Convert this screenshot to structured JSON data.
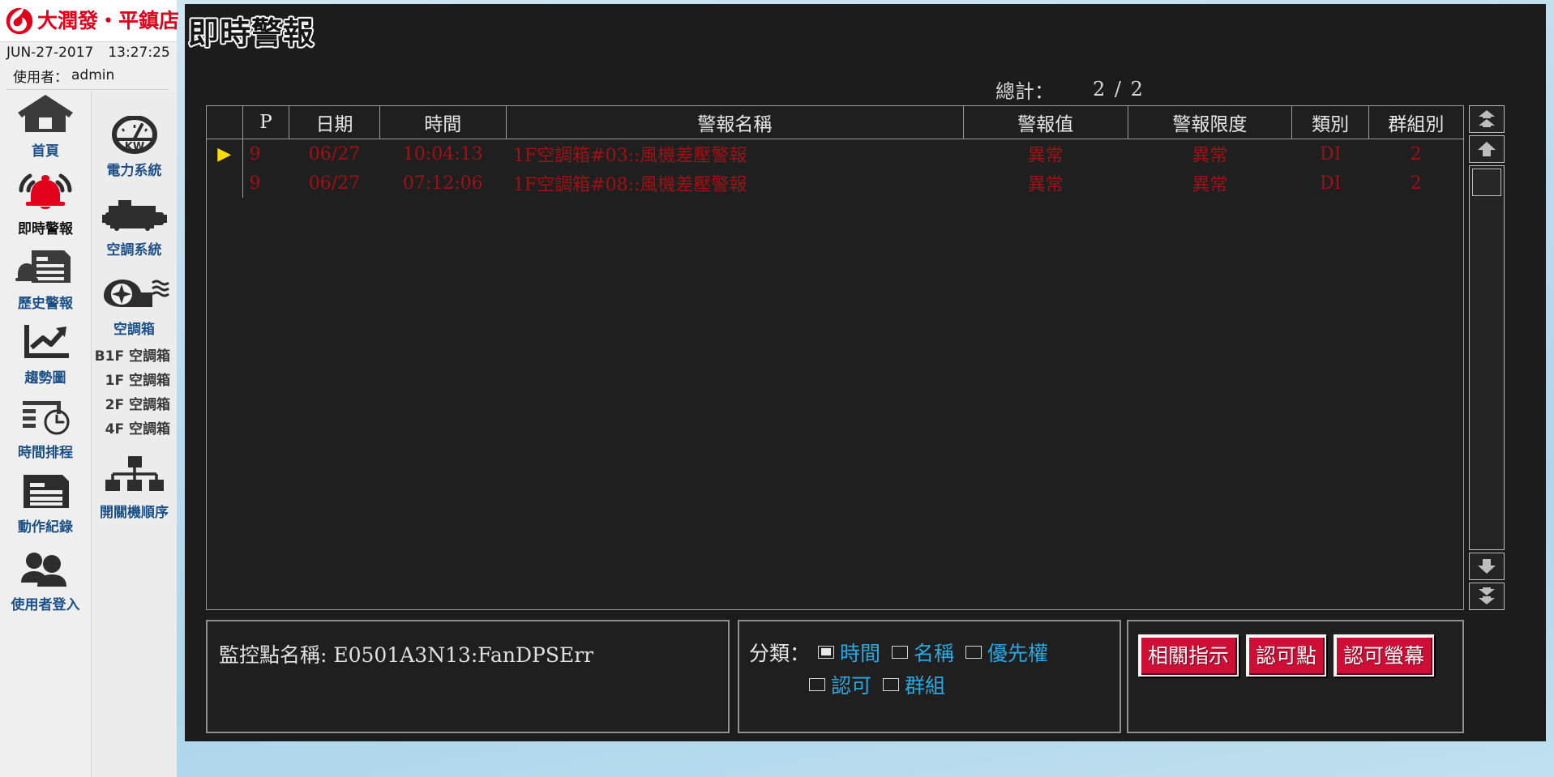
{
  "brand": {
    "name": "大潤發・平鎮店",
    "logo_icon": "rt-mart-logo-icon",
    "logo_color": "#e2001a"
  },
  "status_bar": {
    "date": "JUN-27-2017",
    "time": "13:27:25",
    "user_label": "使用者：",
    "user_value": "admin"
  },
  "sidebar": {
    "main_items": [
      {
        "label": "首頁",
        "icon": "home-icon",
        "active": false
      },
      {
        "label": "即時警報",
        "icon": "alarm-bell-icon",
        "active": true
      },
      {
        "label": "歷史警報",
        "icon": "alarm-history-icon",
        "active": false
      },
      {
        "label": "趨勢圖",
        "icon": "trend-chart-icon",
        "active": false
      },
      {
        "label": "時間排程",
        "icon": "schedule-clock-icon",
        "active": false
      },
      {
        "label": "動作紀錄",
        "icon": "action-log-icon",
        "active": false
      },
      {
        "label": "使用者登入",
        "icon": "users-login-icon",
        "active": false
      }
    ],
    "sub_items": [
      {
        "label": "電力系統",
        "icon": "power-meter-icon"
      },
      {
        "label": "空調系統",
        "icon": "chiller-icon"
      },
      {
        "label": "空調箱",
        "icon": "air-handler-fan-icon"
      }
    ],
    "floor_items": [
      {
        "label": "B1F 空調箱"
      },
      {
        "label": "1F 空調箱"
      },
      {
        "label": "2F 空調箱"
      },
      {
        "label": "4F 空調箱"
      }
    ],
    "sequence_item": {
      "label": "開關機順序",
      "icon": "hierarchy-sequence-icon"
    }
  },
  "page": {
    "title": "即時警報",
    "total_label": "總計：",
    "total_value": "2 / 2"
  },
  "table": {
    "columns": [
      {
        "key": "sel",
        "label": ""
      },
      {
        "key": "p",
        "label": "P"
      },
      {
        "key": "date",
        "label": "日期"
      },
      {
        "key": "time",
        "label": "時間"
      },
      {
        "key": "name",
        "label": "警報名稱"
      },
      {
        "key": "value",
        "label": "警報值"
      },
      {
        "key": "limit",
        "label": "警報限度"
      },
      {
        "key": "type",
        "label": "類別"
      },
      {
        "key": "group",
        "label": "群組別"
      }
    ],
    "rows": [
      {
        "selected_marker": "▶",
        "p": "9",
        "date": "06/27",
        "time": "10:04:13",
        "name": "1F空調箱#03::風機差壓警報",
        "value": "異常",
        "limit": "異常",
        "type": "DI",
        "group": "2"
      },
      {
        "selected_marker": "",
        "p": "9",
        "date": "06/27",
        "time": "07:12:06",
        "name": "1F空調箱#08::風機差壓警報",
        "value": "異常",
        "limit": "異常",
        "type": "DI",
        "group": "2"
      }
    ],
    "row_text_color": "#a01014",
    "header_text_color": "#e8e8e8",
    "marker_color": "#ffdd00"
  },
  "scrollbar": {
    "buttons": [
      {
        "name": "scroll-top-button",
        "icon": "double-up-arrow-icon"
      },
      {
        "name": "scroll-up-button",
        "icon": "up-arrow-icon"
      },
      {
        "name": "scroll-down-button",
        "icon": "down-arrow-icon"
      },
      {
        "name": "scroll-bottom-button",
        "icon": "double-down-arrow-icon"
      }
    ]
  },
  "point_panel": {
    "text": "監控點名稱: E0501A3N13:FanDPSErr"
  },
  "filter_panel": {
    "label": "分類：",
    "options": [
      {
        "label": "時間",
        "checked": true
      },
      {
        "label": "名稱",
        "checked": false
      },
      {
        "label": "優先權",
        "checked": false
      },
      {
        "label": "認可",
        "checked": false
      },
      {
        "label": "群組",
        "checked": false
      }
    ],
    "option_color": "#2aa8e0"
  },
  "actions_panel": {
    "buttons": [
      {
        "label": "相關指示"
      },
      {
        "label": "認可點"
      },
      {
        "label": "認可螢幕"
      }
    ],
    "button_color": "#cf0e35"
  }
}
